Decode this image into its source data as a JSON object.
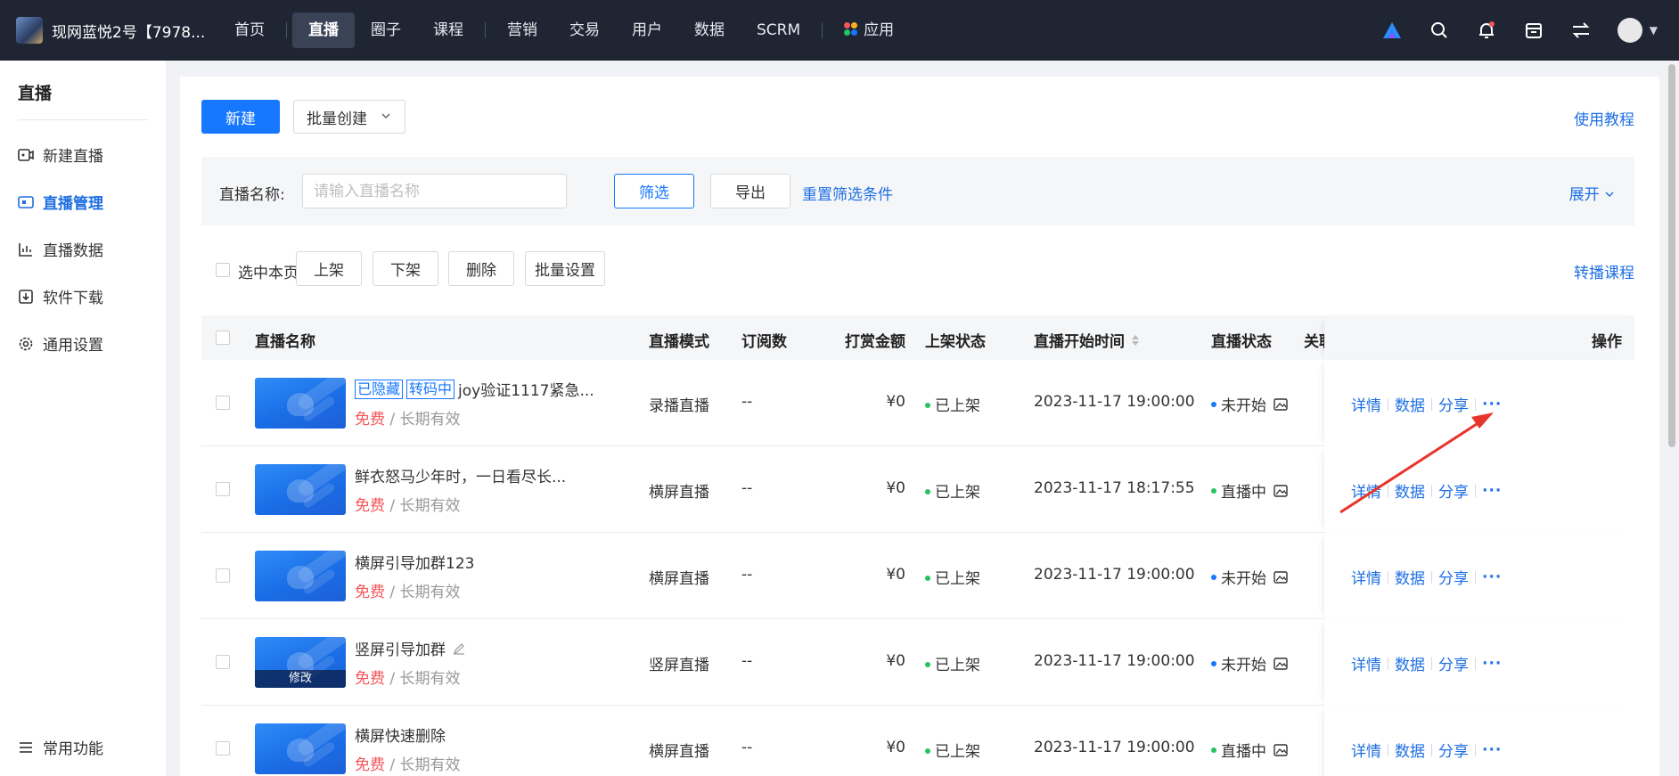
{
  "topbar": {
    "shop_name": "现网蓝悦2号【7978...",
    "nav": [
      "首页",
      "直播",
      "圈子",
      "课程",
      "营销",
      "交易",
      "用户",
      "数据",
      "SCRM",
      "应用"
    ],
    "active_nav": "直播"
  },
  "sidebar": {
    "title": "直播",
    "items": [
      {
        "label": "新建直播",
        "icon": "video-plus-icon"
      },
      {
        "label": "直播管理",
        "icon": "live-screen-icon"
      },
      {
        "label": "直播数据",
        "icon": "chart-icon"
      },
      {
        "label": "软件下载",
        "icon": "download-icon"
      },
      {
        "label": "通用设置",
        "icon": "gear-icon"
      }
    ],
    "bottom": "常用功能"
  },
  "toolbar": {
    "new_label": "新建",
    "batch_create_label": "批量创建",
    "tutorial_label": "使用教程"
  },
  "filter": {
    "label": "直播名称:",
    "placeholder": "请输入直播名称",
    "filter_btn": "筛选",
    "export_btn": "导出",
    "reset": "重置筛选条件",
    "expand": "展开"
  },
  "bulk": {
    "select_page": "选中本页",
    "buttons": [
      "上架",
      "下架",
      "删除",
      "批量设置"
    ],
    "relay": "转播课程"
  },
  "table": {
    "headers": {
      "name": "直播名称",
      "mode": "直播模式",
      "subs": "订阅数",
      "amount": "打赏金额",
      "shelf": "上架状态",
      "start": "直播开始时间",
      "status": "直播状态",
      "related": "关联",
      "ops": "操作"
    },
    "ops_labels": {
      "detail": "详情",
      "data": "数据",
      "share": "分享",
      "more": "···"
    },
    "pricing": {
      "free": "免费",
      "validity": "/ 长期有效"
    },
    "edit_label": "修改",
    "rows": [
      {
        "tags": [
          "已隐藏",
          "转码中"
        ],
        "name": "joy验证1117紧急...",
        "mode": "录播直播",
        "subs": "--",
        "amount": "¥0",
        "shelf": "已上架",
        "start": "2023-11-17 19:00:00",
        "status": "未开始",
        "status_color": "#1677ff"
      },
      {
        "tags": [],
        "name": "鲜衣怒马少年时，一日看尽长...",
        "mode": "横屏直播",
        "subs": "--",
        "amount": "¥0",
        "shelf": "已上架",
        "start": "2023-11-17 18:17:55",
        "status": "直播中",
        "status_color": "#22c55e"
      },
      {
        "tags": [],
        "name": "横屏引导加群123",
        "mode": "横屏直播",
        "subs": "--",
        "amount": "¥0",
        "shelf": "已上架",
        "start": "2023-11-17 19:00:00",
        "status": "未开始",
        "status_color": "#1677ff"
      },
      {
        "tags": [],
        "name": "竖屏引导加群",
        "mode": "竖屏直播",
        "subs": "--",
        "amount": "¥0",
        "shelf": "已上架",
        "start": "2023-11-17 19:00:00",
        "status": "未开始",
        "status_color": "#1677ff"
      },
      {
        "tags": [],
        "name": "横屏快速删除",
        "mode": "横屏直播",
        "subs": "--",
        "amount": "¥0",
        "shelf": "已上架",
        "start": "2023-11-17 19:00:00",
        "status": "直播中",
        "status_color": "#22c55e"
      }
    ]
  },
  "colors": {
    "accent": "#1677ff",
    "topbar": "#1f2533",
    "free": "#f5555a",
    "annotation": "#e8352b",
    "shelf_dot": "#22c55e"
  }
}
